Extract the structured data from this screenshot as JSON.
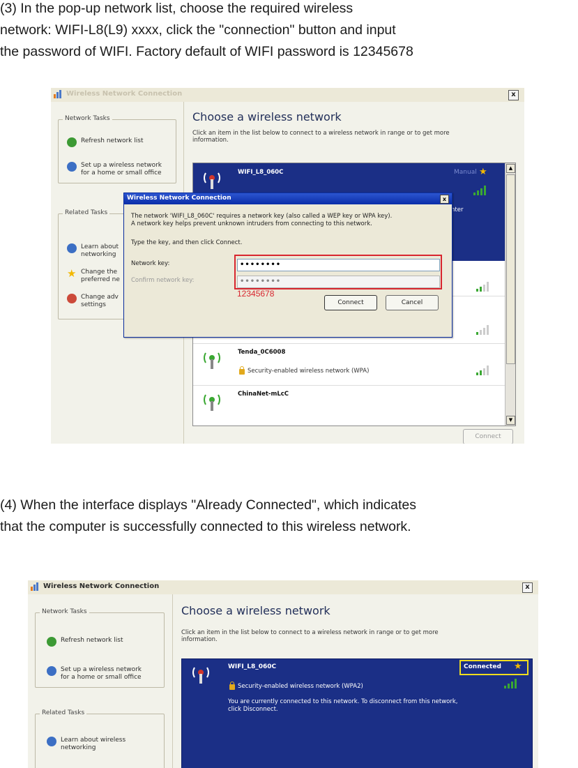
{
  "step3": {
    "line1": "(3) In the pop-up network list, choose the required wireless",
    "line2": "network: WIFI-L8(L9) xxxx, click the \"connection\" button and input",
    "line3": "the password of WIFI. Factory default of WIFI password is 12345678"
  },
  "step4": {
    "line1": "(4) When the interface displays \"Already Connected\", which indicates",
    "line2": "that the computer is successfully connected to this wireless network."
  },
  "window": {
    "title": "Wireless Network Connection",
    "close_label": "x",
    "heading": "Choose a wireless network",
    "intro_line1": "Click an item in the list below to connect to a wireless network in range or to get more",
    "intro_line2": "information."
  },
  "tasks": {
    "network_tasks_title": "Network Tasks",
    "refresh": "Refresh network list",
    "setup_line1": "Set up a wireless network",
    "setup_line2": "for a home or small office",
    "related_tasks_title": "Related Tasks",
    "learn_line1": "Learn about",
    "learn_line2": "networking",
    "learn_full_line1": "Learn about wireless",
    "change_order_line1": "Change the",
    "change_order_line2": "preferred ne",
    "change_adv_line1": "Change adv",
    "change_adv_line2": "settings"
  },
  "networks1": [
    {
      "name": "WIFI_L8_060C",
      "badge": "Manual",
      "partial": "nter"
    },
    {
      "name": "Tenda_0C6008",
      "desc": "Security-enabled wireless network (WPA)"
    },
    {
      "name": "ChinaNet-mLcC"
    }
  ],
  "dialog": {
    "title": "Wireless Network Connection",
    "close_label": "x",
    "msg_line1": "The network 'WIFI_L8_060C' requires a network key (also called a WEP key or WPA key).",
    "msg_line2": "A network key helps prevent unknown intruders from connecting to this network.",
    "instruction": "Type the key, and then click Connect.",
    "key_label": "Network key:",
    "key_value": "••••••••",
    "confirm_label": "Confirm network key:",
    "confirm_value": "••••••••",
    "password_note": "12345678",
    "connect_label": "Connect",
    "cancel_label": "Cancel"
  },
  "connect_button": "Connect",
  "network2": {
    "name": "WIFI_L8_060C",
    "badge": "Connected",
    "desc": "Security-enabled wireless network (WPA2)",
    "msg_line1": "You are currently connected to this network. To disconnect from this network,",
    "msg_line2": "click Disconnect."
  },
  "colors": {
    "selected_row": "#1b2f86",
    "highlight_red": "#d8262f",
    "highlight_yellow": "#f0dd1e",
    "star": "#f3b800",
    "signal_green": "#3aa832"
  },
  "icons": [
    "wireless-network-icon",
    "refresh-icon",
    "setup-network-icon",
    "info-icon",
    "star-icon",
    "change-settings-icon",
    "antenna-icon",
    "signal-bars-icon",
    "lock-icon"
  ]
}
